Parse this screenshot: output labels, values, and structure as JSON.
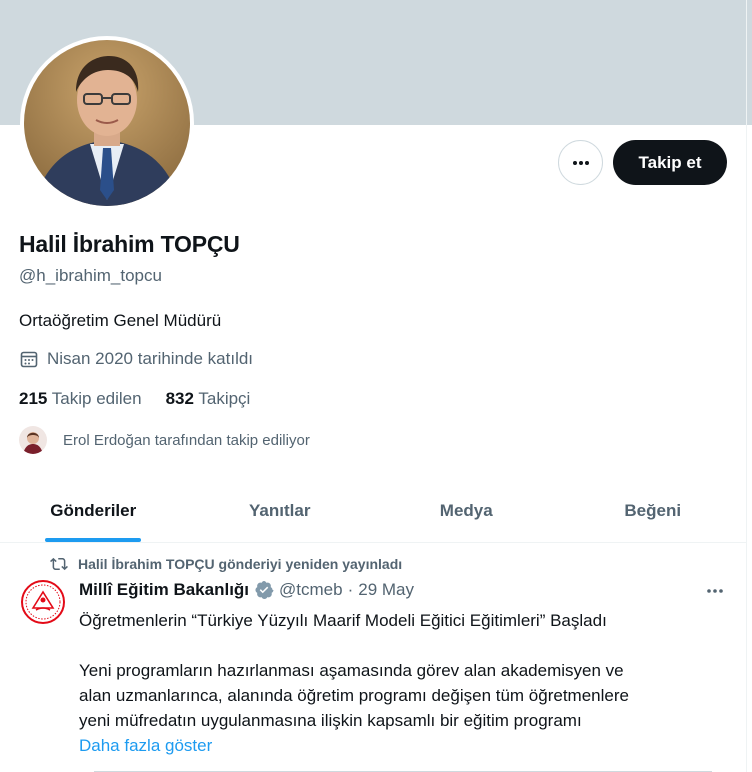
{
  "profile": {
    "name": "Halil İbrahim TOPÇU",
    "handle": "@h_ibrahim_topcu",
    "bio": "Ortaöğretim Genel Müdürü",
    "joined": "Nisan 2020 tarihinde katıldı",
    "following_count": "215",
    "following_label": "Takip edilen",
    "followers_count": "832",
    "followers_label": "Takipçi",
    "followed_by": "Erol Erdoğan tarafından takip ediliyor"
  },
  "actions": {
    "follow_label": "Takip et",
    "more_icon": "more-horizontal-icon"
  },
  "tabs": [
    {
      "label": "Gönderiler",
      "active": true
    },
    {
      "label": "Yanıtlar",
      "active": false
    },
    {
      "label": "Medya",
      "active": false
    },
    {
      "label": "Beğeni",
      "active": false
    }
  ],
  "post": {
    "retweet_text": "Halil İbrahim TOPÇU gönderiyi yeniden yayınladı",
    "author": "Millî Eğitim Bakanlığı",
    "handle": "@tcmeb",
    "separator": "·",
    "date": "29 May",
    "title_line": "Öğretmenlerin “Türkiye Yüzyılı Maarif Modeli Eğitici Eğitimleri” Başladı",
    "body_lines": [
      "Yeni programların hazırlanması aşamasında görev alan akademisyen ve",
      "alan uzmanlarınca, alanında öğretim programı değişen tüm öğretmenlere",
      "yeni müfredatın uygulanmasına ilişkin kapsamlı bir eğitim programı"
    ],
    "show_more": "Daha fazla göster"
  },
  "colors": {
    "banner": "#cfd9de",
    "accent": "#1d9bf0",
    "verified": "#829aab",
    "text_primary": "#0f1419",
    "text_secondary": "#536471",
    "meb_red": "#e30a17"
  }
}
